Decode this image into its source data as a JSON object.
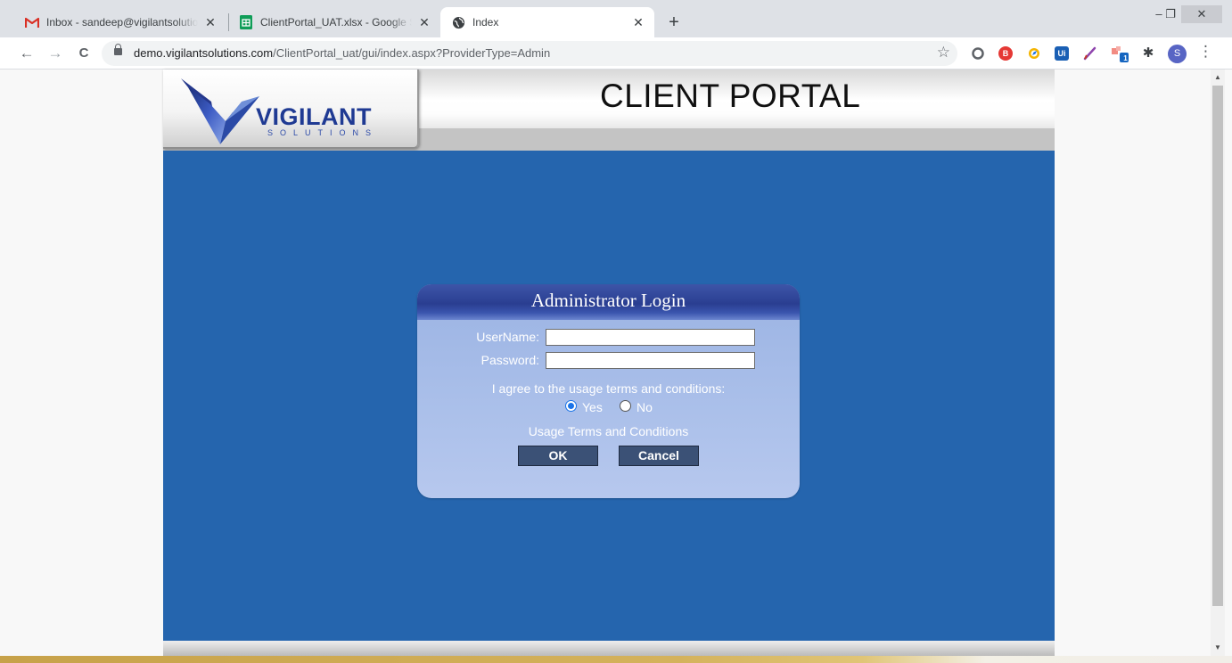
{
  "browser": {
    "tabs": [
      {
        "title": "Inbox - sandeep@vigilantsolutions.com",
        "favicon": "gmail-icon"
      },
      {
        "title": "ClientPortal_UAT.xlsx - Google Sheets",
        "favicon": "sheets-icon"
      },
      {
        "title": "Index",
        "favicon": "globe-icon"
      }
    ],
    "tab_close_glyph": "✕",
    "new_tab_glyph": "+",
    "window_controls": {
      "minimize": "–",
      "restore": "❐",
      "close": "✕"
    },
    "nav": {
      "back": "←",
      "forward": "→",
      "reload": "C"
    },
    "url_host": "demo.vigilantsolutions.com",
    "url_path": "/ClientPortal_uat/gui/index.aspx?ProviderType=Admin",
    "bookmark_glyph": "☆",
    "extensions": [
      {
        "name": "circle-extension-icon",
        "label": "",
        "color": "#5f6368"
      },
      {
        "name": "ublock-extension-icon",
        "label": "B",
        "color": "#e53935"
      },
      {
        "name": "compass-extension-icon",
        "label": "",
        "color": "#f4b400"
      },
      {
        "name": "uipath-extension-icon",
        "label": "Ui",
        "color": "#1a5fb4"
      },
      {
        "name": "pen-extension-icon",
        "label": "",
        "color": "#8e44ad"
      },
      {
        "name": "puzzle-extension-icon",
        "label": "1",
        "color": "#1565c0"
      }
    ],
    "puzzle_glyph": "✱",
    "profile_initial": "S",
    "menu_glyph": "⋮"
  },
  "header": {
    "logo_word": "VIGILANT",
    "logo_sub": "SOLUTIONS",
    "title": "CLIENT PORTAL"
  },
  "login": {
    "title": "Administrator Login",
    "username_label": "UserName:",
    "username_value": "",
    "password_label": "Password:",
    "password_value": "",
    "agree_text": "I agree to the usage terms and conditions:",
    "radio_yes": "Yes",
    "radio_no": "No",
    "selected": "Yes",
    "terms_link": "Usage Terms and Conditions",
    "ok_label": "OK",
    "cancel_label": "Cancel"
  },
  "colors": {
    "portal_blue": "#2565ae",
    "panel_header": "#2a3e91",
    "button": "#3b5176"
  }
}
